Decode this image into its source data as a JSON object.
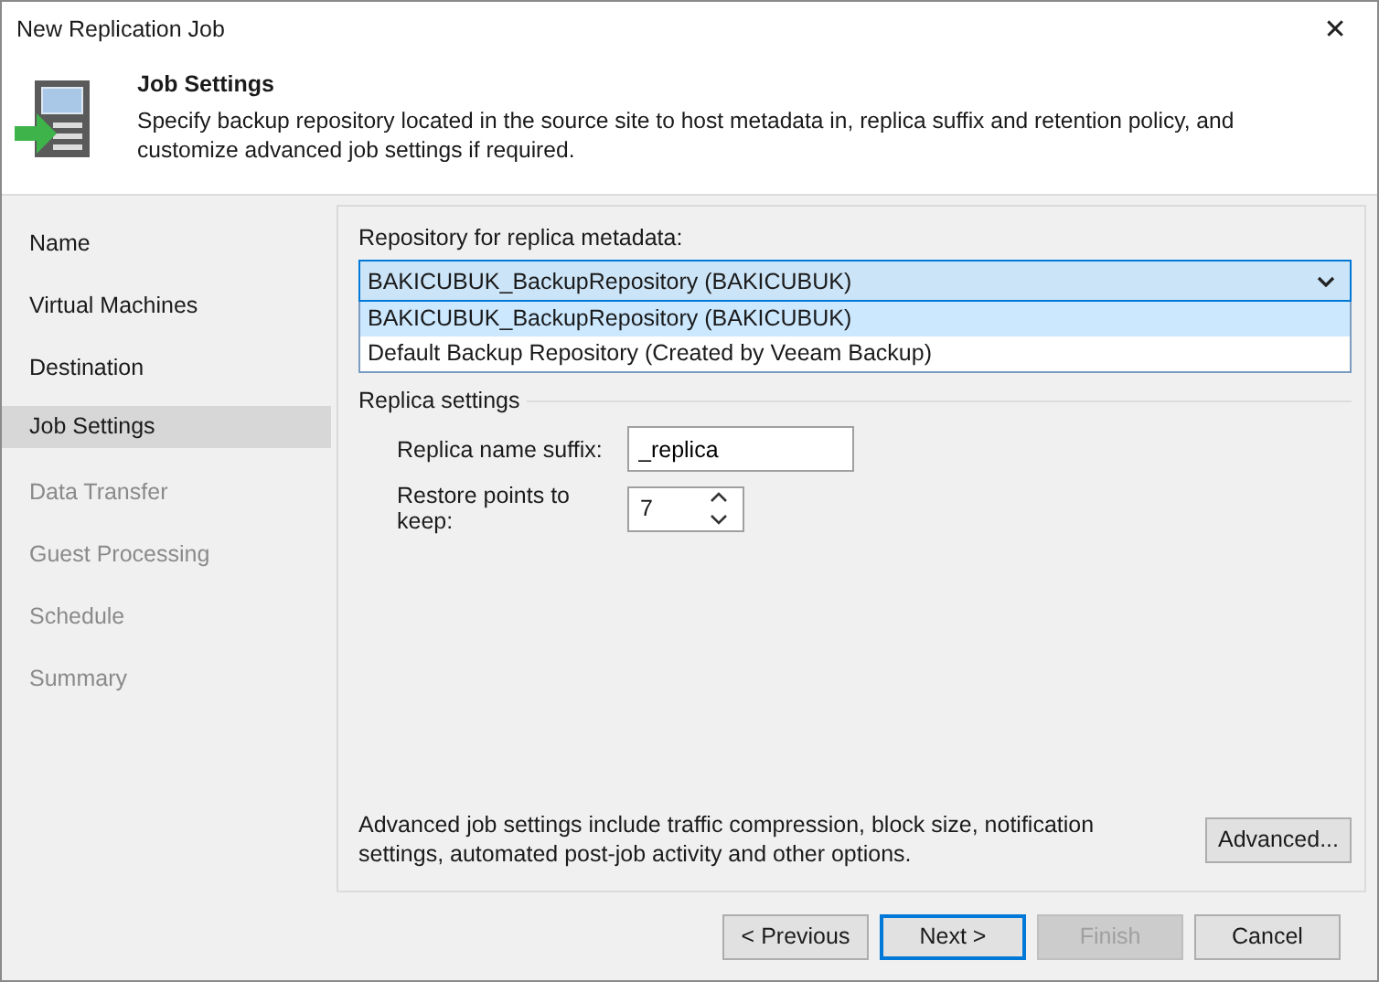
{
  "window": {
    "title": "New Replication Job",
    "close": "✕"
  },
  "header": {
    "title": "Job Settings",
    "description": "Specify backup repository located in the source site to host metadata in, replica suffix and retention policy, and customize advanced job settings if required."
  },
  "sidebar": {
    "items": [
      {
        "label": "Name",
        "selected": false,
        "disabled": false
      },
      {
        "label": "Virtual Machines",
        "selected": false,
        "disabled": false
      },
      {
        "label": "Destination",
        "selected": false,
        "disabled": false
      },
      {
        "label": "Job Settings",
        "selected": true,
        "disabled": false
      },
      {
        "label": "Data Transfer",
        "selected": false,
        "disabled": true
      },
      {
        "label": "Guest Processing",
        "selected": false,
        "disabled": true
      },
      {
        "label": "Schedule",
        "selected": false,
        "disabled": true
      },
      {
        "label": "Summary",
        "selected": false,
        "disabled": true
      }
    ]
  },
  "repository": {
    "label": "Repository for replica metadata:",
    "value": "BAKICUBUK_BackupRepository (BAKICUBUK)",
    "options": [
      {
        "label": "BAKICUBUK_BackupRepository (BAKICUBUK)",
        "selected": true
      },
      {
        "label": "Default Backup Repository (Created by Veeam Backup)",
        "selected": false
      }
    ]
  },
  "replica_settings": {
    "title": "Replica settings",
    "fields": [
      {
        "kind": "text",
        "label": "Replica name suffix:",
        "value": "_replica"
      },
      {
        "kind": "spinner",
        "label": "Restore points to keep:",
        "value": "7"
      }
    ]
  },
  "advanced": {
    "text": "Advanced job settings include traffic compression, block size, notification settings, automated post-job activity and other options.",
    "button": "Advanced..."
  },
  "buttons": [
    {
      "label": "< Previous",
      "disabled": false,
      "focused": false
    },
    {
      "label": "Next >",
      "disabled": false,
      "focused": true
    },
    {
      "label": "Finish",
      "disabled": true,
      "focused": false
    },
    {
      "label": "Cancel",
      "disabled": false,
      "focused": false
    }
  ]
}
